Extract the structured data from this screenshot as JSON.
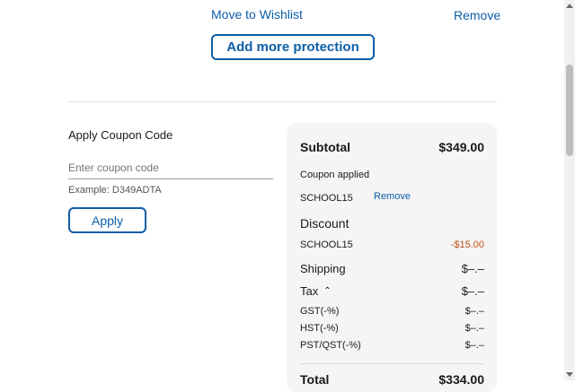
{
  "cart_item": {
    "move_to_wishlist": "Move to Wishlist",
    "remove": "Remove",
    "add_protection": "Add more protection"
  },
  "coupon": {
    "heading": "Apply Coupon Code",
    "placeholder": "Enter coupon code",
    "example": "Example: D349ADTA",
    "apply": "Apply"
  },
  "summary": {
    "subtotal_label": "Subtotal",
    "subtotal_value": "$349.00",
    "coupon_applied": "Coupon applied",
    "coupon_code": "SCHOOL15",
    "coupon_remove": "Remove",
    "discount_label": "Discount",
    "discount_code": "SCHOOL15",
    "discount_value": "-$15.00",
    "shipping_label": "Shipping",
    "shipping_value": "$–.–",
    "tax_label": "Tax",
    "tax_value": "$–.–",
    "gst_label": "GST(-%)",
    "gst_value": "$–.–",
    "hst_label": "HST(-%)",
    "hst_value": "$–.–",
    "pst_label": "PST/QST(-%)",
    "pst_value": "$–.–",
    "total_label": "Total",
    "total_value": "$334.00"
  },
  "colors": {
    "accent": "#0d5ea8",
    "discount": "#c4501c",
    "panel": "#f5f5f5"
  }
}
